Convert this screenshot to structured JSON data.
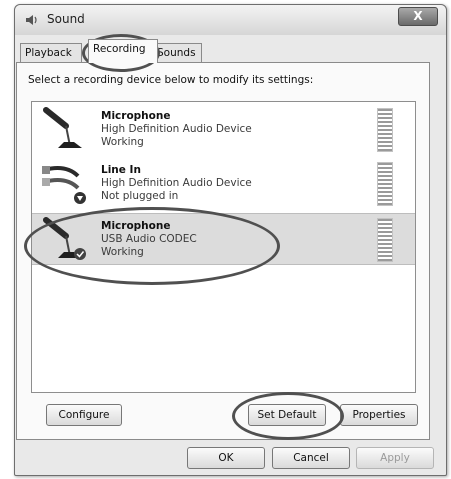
{
  "window": {
    "title": "Sound",
    "close_symbol": "X"
  },
  "tabs": [
    {
      "label": "Playback"
    },
    {
      "label": "Recording",
      "active": true
    },
    {
      "label": "Sounds"
    }
  ],
  "instruction": "Select a recording device below to modify its settings:",
  "devices": [
    {
      "name": "Microphone",
      "description": "High Definition Audio Device",
      "status": "Working",
      "icon": "microphone-icon"
    },
    {
      "name": "Line In",
      "description": "High Definition Audio Device",
      "status": "Not plugged in",
      "icon": "line-in-jack-icon"
    },
    {
      "name": "Microphone",
      "description": "USB Audio CODEC",
      "status": "Working",
      "icon": "microphone-icon",
      "selected": true,
      "is_default": true
    }
  ],
  "buttons": {
    "configure": "Configure",
    "set_default": "Set Default",
    "properties": "Properties",
    "ok": "OK",
    "cancel": "Cancel",
    "apply": "Apply"
  },
  "colors": {
    "highlight_ring": "#505050",
    "selected_row": "#dcdcdc"
  }
}
